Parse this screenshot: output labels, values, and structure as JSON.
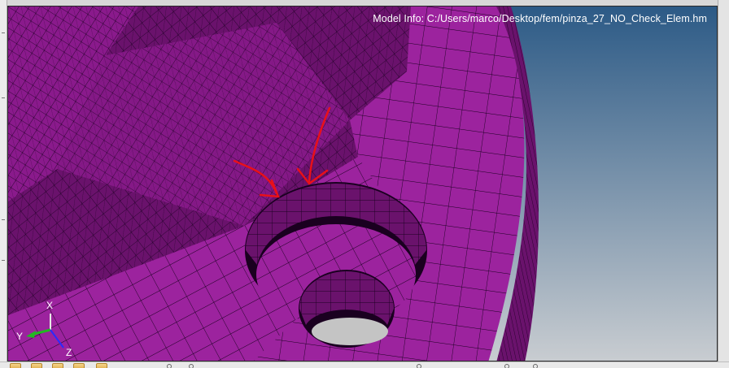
{
  "viewport": {
    "model_info": "Model Info: C:/Users/marco/Desktop/fem/pinza_27_NO_Check_Elem.hm",
    "background_top": "#2c5a86",
    "background_bottom": "#c9cdd1",
    "mesh_color": "#8a1a8c",
    "mesh_color_light": "#9c239e",
    "mesh_color_dark": "#6a126c",
    "annotation_color": "#e8101a"
  },
  "triad": {
    "x_label": "X",
    "y_label": "Y",
    "z_label": "Z"
  },
  "toolbar": {
    "icons": [
      "panel-icon",
      "panel-icon",
      "panel-icon",
      "panel-icon",
      "folder-icon"
    ]
  }
}
